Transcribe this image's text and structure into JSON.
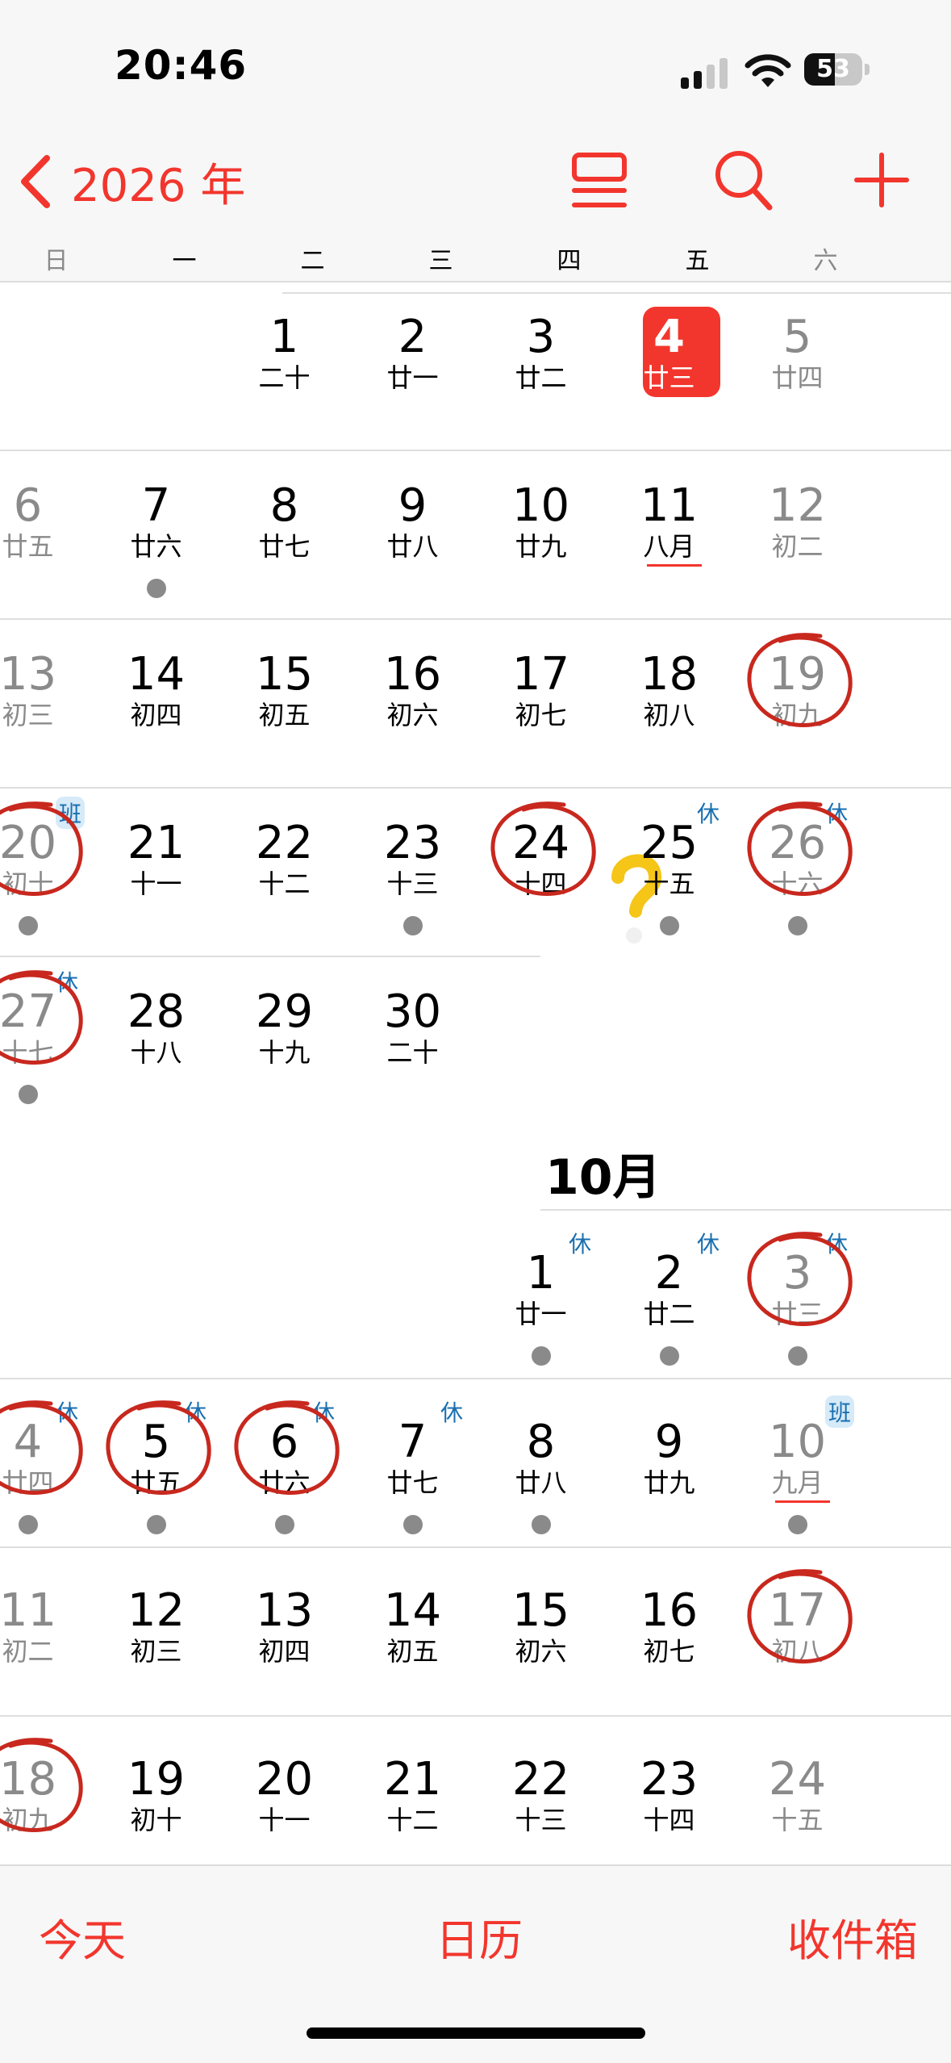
{
  "status_bar": {
    "time": "20:46",
    "battery_percent": "53",
    "battery_level": 0.53
  },
  "nav": {
    "year": "2026 年",
    "icons": [
      "chevron-left-icon",
      "list-icon",
      "search-icon",
      "plus-icon"
    ],
    "accent_color": "#f2362d"
  },
  "weekdays": [
    "日",
    "一",
    "二",
    "三",
    "四",
    "五",
    "六"
  ],
  "september_days": [
    {
      "day": "1",
      "lunar": "二十"
    },
    {
      "day": "2",
      "lunar": "廿一"
    },
    {
      "day": "3",
      "lunar": "廿二"
    },
    {
      "day": "4",
      "lunar": "廿三",
      "today": true
    },
    {
      "day": "5",
      "lunar": "廿四"
    },
    {
      "day": "6",
      "lunar": "廿五"
    },
    {
      "day": "7",
      "lunar": "廿六",
      "dot": true
    },
    {
      "day": "8",
      "lunar": "廿七"
    },
    {
      "day": "9",
      "lunar": "廿八"
    },
    {
      "day": "10",
      "lunar": "廿九"
    },
    {
      "day": "11",
      "lunar": "八月",
      "month_start": true
    },
    {
      "day": "12",
      "lunar": "初二"
    },
    {
      "day": "13",
      "lunar": "初三"
    },
    {
      "day": "14",
      "lunar": "初四"
    },
    {
      "day": "15",
      "lunar": "初五"
    },
    {
      "day": "16",
      "lunar": "初六"
    },
    {
      "day": "17",
      "lunar": "初七"
    },
    {
      "day": "18",
      "lunar": "初八"
    },
    {
      "day": "19",
      "lunar": "初九",
      "circled": true
    },
    {
      "day": "20",
      "lunar": "初十",
      "badge": "班",
      "dot": true,
      "circled": true
    },
    {
      "day": "21",
      "lunar": "十一"
    },
    {
      "day": "22",
      "lunar": "十二"
    },
    {
      "day": "23",
      "lunar": "十三",
      "dot": true
    },
    {
      "day": "24",
      "lunar": "十四",
      "circled": true
    },
    {
      "day": "25",
      "lunar": "十五",
      "badge": "休",
      "dot": true
    },
    {
      "day": "26",
      "lunar": "十六",
      "badge": "休",
      "dot": true,
      "circled": true
    },
    {
      "day": "27",
      "lunar": "十七",
      "badge": "休",
      "dot": true,
      "circled": true
    },
    {
      "day": "28",
      "lunar": "十八"
    },
    {
      "day": "29",
      "lunar": "十九"
    },
    {
      "day": "30",
      "lunar": "二十"
    }
  ],
  "october": {
    "title": "10月",
    "days": [
      {
        "day": "1",
        "lunar": "廿一",
        "badge": "休",
        "dot": true
      },
      {
        "day": "2",
        "lunar": "廿二",
        "badge": "休",
        "dot": true
      },
      {
        "day": "3",
        "lunar": "廿三",
        "badge": "休",
        "dot": true,
        "circled": true
      },
      {
        "day": "4",
        "lunar": "廿四",
        "badge": "休",
        "dot": true,
        "circled": true
      },
      {
        "day": "5",
        "lunar": "廿五",
        "badge": "休",
        "dot": true,
        "circled": true
      },
      {
        "day": "6",
        "lunar": "廿六",
        "badge": "休",
        "dot": true,
        "circled": true
      },
      {
        "day": "7",
        "lunar": "廿七",
        "badge": "休",
        "dot": true
      },
      {
        "day": "8",
        "lunar": "廿八",
        "dot": true
      },
      {
        "day": "9",
        "lunar": "廿九"
      },
      {
        "day": "10",
        "lunar": "九月",
        "badge": "班",
        "dot": true,
        "month_start": true
      },
      {
        "day": "11",
        "lunar": "初二"
      },
      {
        "day": "12",
        "lunar": "初三"
      },
      {
        "day": "13",
        "lunar": "初四"
      },
      {
        "day": "14",
        "lunar": "初五"
      },
      {
        "day": "15",
        "lunar": "初六"
      },
      {
        "day": "16",
        "lunar": "初七"
      },
      {
        "day": "17",
        "lunar": "初八",
        "circled": true
      },
      {
        "day": "18",
        "lunar": "初九",
        "circled": true
      },
      {
        "day": "19",
        "lunar": "初十"
      },
      {
        "day": "20",
        "lunar": "十一"
      },
      {
        "day": "21",
        "lunar": "十二"
      },
      {
        "day": "22",
        "lunar": "十三"
      },
      {
        "day": "23",
        "lunar": "十四"
      },
      {
        "day": "24",
        "lunar": "十五"
      }
    ]
  },
  "tab_bar": {
    "today": "今天",
    "calendars": "日历",
    "inbox": "收件箱"
  }
}
